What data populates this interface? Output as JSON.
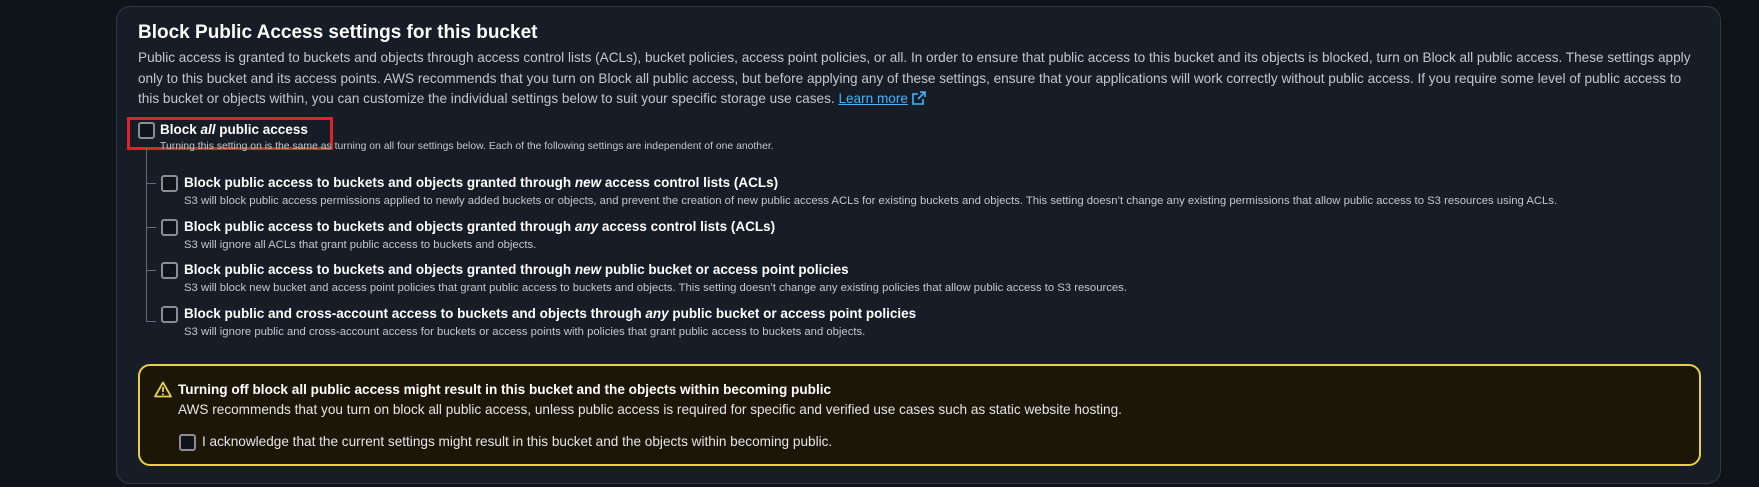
{
  "section": {
    "title": "Block Public Access settings for this bucket",
    "description": "Public access is granted to buckets and objects through access control lists (ACLs), bucket policies, access point policies, or all. In order to ensure that public access to this bucket and its objects is blocked, turn on Block all public access. These settings apply only to this bucket and its access points. AWS recommends that you turn on Block all public access, but before applying any of these settings, ensure that your applications will work correctly without public access. If you require some level of public access to this bucket or objects within, you can customize the individual settings below to suit your specific storage use cases.",
    "learn_more": "Learn more"
  },
  "block_all": {
    "label_pre": "Block ",
    "label_em": "all",
    "label_post": " public access",
    "desc": "Turning this setting on is the same as turning on all four settings below. Each of the following settings are independent of one another.",
    "checked": false
  },
  "options": [
    {
      "label_pre": "Block public access to buckets and objects granted through ",
      "label_em": "new",
      "label_post": " access control lists (ACLs)",
      "desc": "S3 will block public access permissions applied to newly added buckets or objects, and prevent the creation of new public access ACLs for existing buckets and objects. This setting doesn’t change any existing permissions that allow public access to S3 resources using ACLs.",
      "checked": false
    },
    {
      "label_pre": "Block public access to buckets and objects granted through ",
      "label_em": "any",
      "label_post": " access control lists (ACLs)",
      "desc": "S3 will ignore all ACLs that grant public access to buckets and objects.",
      "checked": false
    },
    {
      "label_pre": "Block public access to buckets and objects granted through ",
      "label_em": "new",
      "label_post": " public bucket or access point policies",
      "desc": "S3 will block new bucket and access point policies that grant public access to buckets and objects. This setting doesn’t change any existing policies that allow public access to S3 resources.",
      "checked": false
    },
    {
      "label_pre": "Block public and cross-account access to buckets and objects through ",
      "label_em": "any",
      "label_post": " public bucket or access point policies",
      "desc": "S3 will ignore public and cross-account access for buckets or access points with policies that grant public access to buckets and objects.",
      "checked": false
    }
  ],
  "warning": {
    "title": "Turning off block all public access might result in this bucket and the objects within becoming public",
    "body": "AWS recommends that you turn on block all public access, unless public access is required for specific and verified use cases such as static website hosting.",
    "acknowledge": "I acknowledge that the current settings might result in this bucket and the objects within becoming public.",
    "acknowledged": false
  },
  "colors": {
    "highlight": "#e0202a",
    "warning_border": "#e8cf4a",
    "link": "#42b4ff"
  }
}
